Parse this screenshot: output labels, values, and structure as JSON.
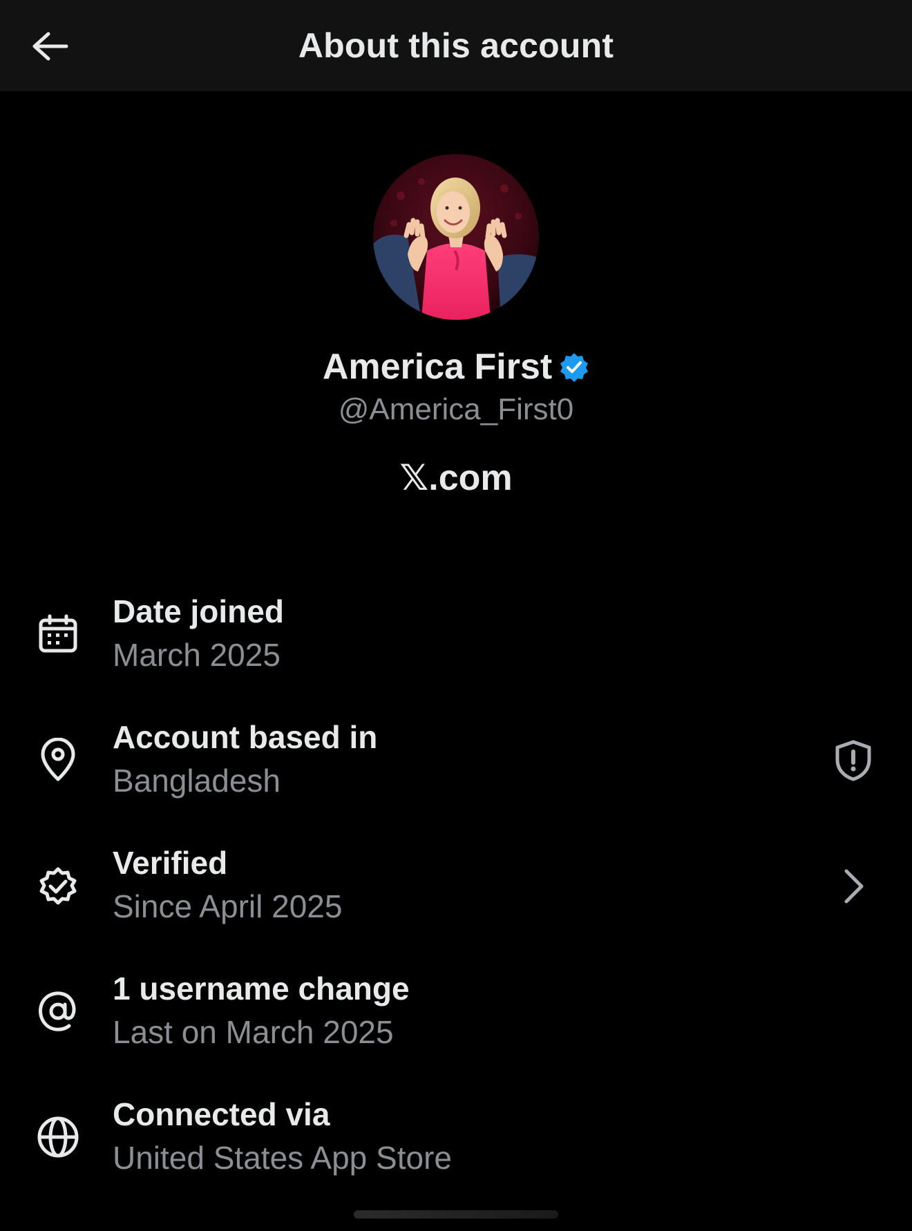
{
  "header": {
    "title": "About this account",
    "back_icon": "arrow-left-icon"
  },
  "profile": {
    "display_name": "America First",
    "verified": true,
    "verified_badge_color": "#1d9bf0",
    "handle": "@America_First0",
    "site": "𝕏.com"
  },
  "details": [
    {
      "icon": "calendar-icon",
      "title": "Date joined",
      "value": "March 2025"
    },
    {
      "icon": "location-pin-icon",
      "title": "Account based in",
      "value": "Bangladesh",
      "action_icon": "shield-alert-icon"
    },
    {
      "icon": "verified-seal-icon",
      "title": "Verified",
      "value": "Since April 2025",
      "action_icon": "chevron-right-icon"
    },
    {
      "icon": "at-sign-icon",
      "title": "1 username change",
      "value": "Last on March 2025"
    },
    {
      "icon": "globe-icon",
      "title": "Connected via",
      "value": "United States App Store"
    }
  ],
  "colors": {
    "background": "#000000",
    "header_background": "#121212",
    "primary_text": "#e7e9ea",
    "secondary_text": "#8b8f94",
    "accent": "#1d9bf0"
  }
}
